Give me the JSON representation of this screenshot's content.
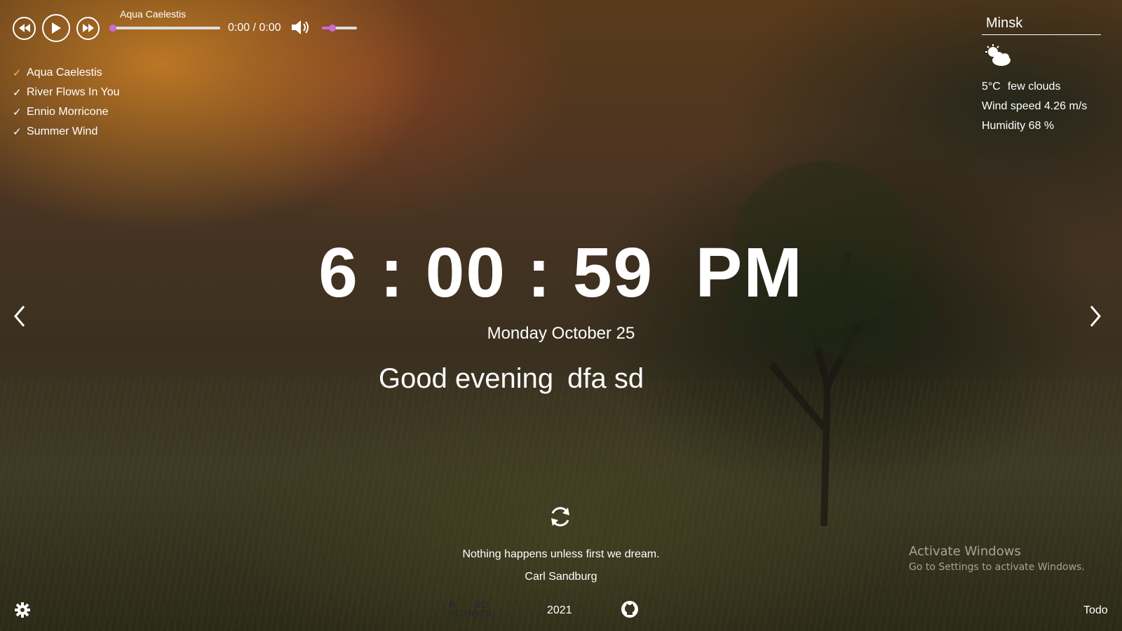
{
  "player": {
    "current_track": "Aqua Caelestis",
    "time": "0:00 / 0:00",
    "progress_fraction": 0,
    "volume_fraction": 0.3,
    "playlist": [
      {
        "title": "Aqua Caelestis",
        "active": true
      },
      {
        "title": "River Flows In You",
        "active": false
      },
      {
        "title": "Ennio Morricone",
        "active": false
      },
      {
        "title": "Summer Wind",
        "active": false
      }
    ],
    "check_glyph": "✓"
  },
  "weather": {
    "city": "Minsk",
    "icon": "few-clouds-icon",
    "temperature": "5°C",
    "description": "few clouds",
    "wind": "Wind speed 4.26 m/s",
    "humidity": "Humidity 68 %"
  },
  "clock": {
    "time": "6 : 00 : 59  PM",
    "date": "Monday October 25"
  },
  "greeting": {
    "text": "Good evening",
    "name": "dfa sd"
  },
  "quote": {
    "text": "Nothing happens unless first we dream.",
    "author": "Carl Sandburg"
  },
  "footer": {
    "logo": "RS SCHOOL",
    "year": "2021",
    "todo": "Todo"
  },
  "activation_watermark": {
    "title": "Activate Windows",
    "subtitle": "Go to Settings to activate Windows."
  },
  "colors": {
    "accent": "#c86dd7",
    "active_track": "#e8c04f",
    "text": "#ffffff"
  }
}
